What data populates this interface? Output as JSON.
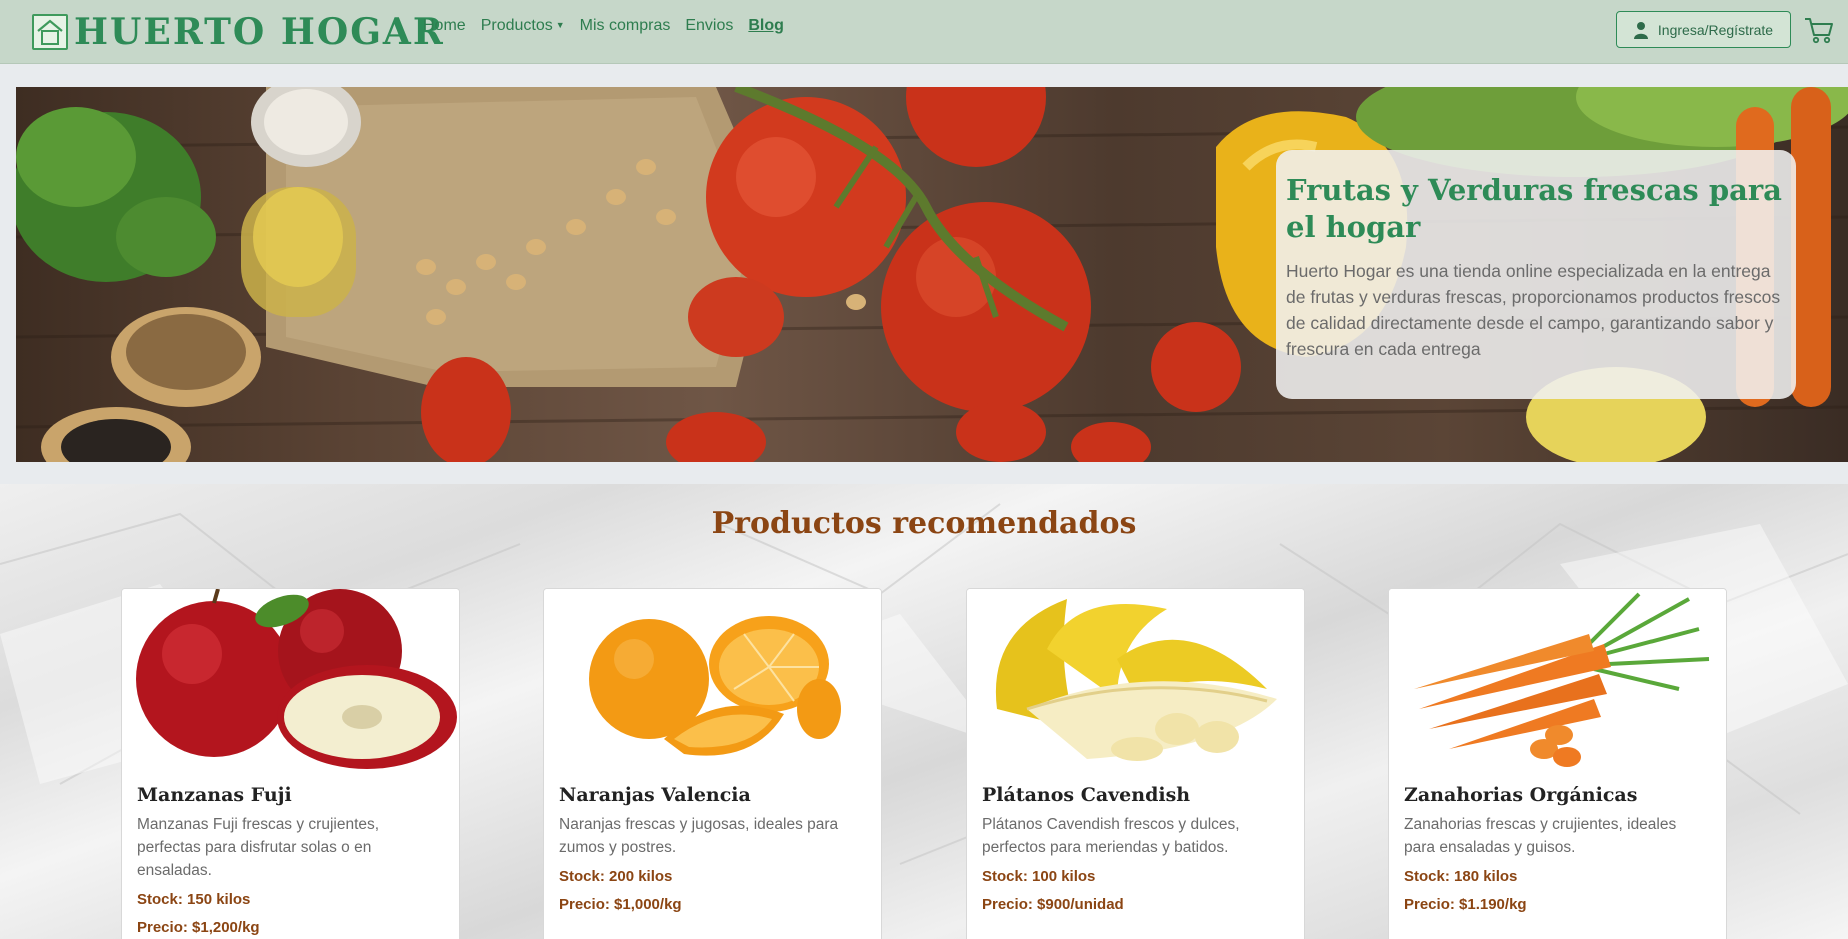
{
  "brand": {
    "name": "HUERTO HOGAR",
    "color": "#2e8b57"
  },
  "nav": {
    "items": [
      {
        "label": "Home"
      },
      {
        "label": "Productos",
        "dropdown": true
      },
      {
        "label": "Mis compras"
      },
      {
        "label": "Envios"
      },
      {
        "label": "Blog",
        "active": true
      }
    ]
  },
  "header": {
    "login_label": "Ingresa/Regístrate",
    "login_icon": "user-icon",
    "cart_icon": "cart-icon"
  },
  "hero": {
    "title": "Frutas y Verduras frescas para el hogar",
    "text": "Huerto Hogar es una tienda online especializada en la entrega de frutas y verduras frescas, proporcionamos productos frescos de calidad directamente desde el campo, garantizando sabor y frescura en cada entrega"
  },
  "products": {
    "title": "Productos recomendados",
    "items": [
      {
        "name": "Manzanas Fuji",
        "description": "Manzanas Fuji frescas y crujientes, perfectas para disfrutar solas o en ensaladas.",
        "stock": "Stock: 150 kilos",
        "price": "Precio: $1,200/kg",
        "image": "apples-image"
      },
      {
        "name": "Naranjas Valencia",
        "description": "Naranjas frescas y jugosas, ideales para zumos y postres.",
        "stock": "Stock: 200 kilos",
        "price": "Precio: $1,000/kg",
        "image": "oranges-image"
      },
      {
        "name": "Plátanos Cavendish",
        "description": "Plátanos Cavendish frescos y dulces, perfectos para meriendas y batidos.",
        "stock": "Stock: 100 kilos",
        "price": "Precio: $900/unidad",
        "image": "bananas-image"
      },
      {
        "name": "Zanahorias Orgánicas",
        "description": "Zanahorias frescas y crujientes, ideales para ensaladas y guisos.",
        "stock": "Stock: 180 kilos",
        "price": "Precio: $1.190/kg",
        "image": "carrots-image"
      }
    ]
  },
  "colors": {
    "accent": "#2e8b57",
    "secondary": "#8b4513",
    "navbar_bg": "#c6d7c9"
  }
}
